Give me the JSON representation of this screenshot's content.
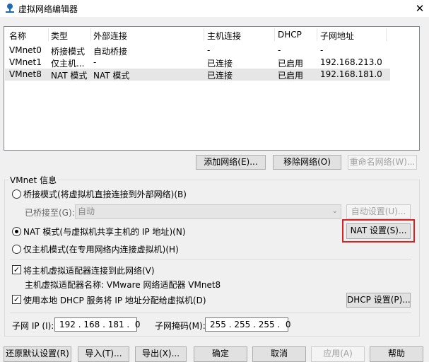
{
  "window": {
    "title": "虚拟网络编辑器",
    "close_glyph": "✕"
  },
  "table": {
    "columns": [
      "名称",
      "类型",
      "外部连接",
      "主机连接",
      "DHCP",
      "子网地址"
    ],
    "rows": [
      {
        "name": "VMnet0",
        "type": "桥接模式",
        "external": "自动桥接",
        "host": "-",
        "dhcp": "-",
        "subnet": "-",
        "selected": false
      },
      {
        "name": "VMnet1",
        "type": "仅主机...",
        "external": "-",
        "host": "已连接",
        "dhcp": "已启用",
        "subnet": "192.168.213.0",
        "selected": false
      },
      {
        "name": "VMnet8",
        "type": "NAT 模式",
        "external": "NAT 模式",
        "host": "已连接",
        "dhcp": "已启用",
        "subnet": "192.168.181.0",
        "selected": true
      }
    ]
  },
  "table_buttons": {
    "add": "添加网络(E)...",
    "remove": "移除网络(O)",
    "rename": "重命名网络(W)..."
  },
  "vmnet_info": {
    "group_title": "VMnet 信息",
    "bridged_label": "桥接模式(将虚拟机直接连接到外部网络)(B)",
    "bridged_to_label": "已桥接至(G):",
    "bridged_to_value": "自动",
    "auto_settings": "自动设置(U)...",
    "nat_label": "NAT 模式(与虚拟机共享主机的 IP 地址)(N)",
    "nat_settings": "NAT 设置(S)...",
    "hostonly_label": "仅主机模式(在专用网络内连接虚拟机)(H)",
    "mode_selected": "nat",
    "connect_adapter_label": "将主机虚拟适配器连接到此网络(V)",
    "connect_adapter_checked": true,
    "adapter_name_label": "主机虚拟适配器名称: VMware 网络适配器 VMnet8",
    "dhcp_label": "使用本地 DHCP 服务将 IP 地址分配给虚拟机(D)",
    "dhcp_checked": true,
    "dhcp_settings": "DHCP 设置(P)...",
    "subnet_ip_label": "子网 IP (I):",
    "subnet_ip_value": "192 . 168 . 181 .  0",
    "subnet_mask_label": "子网掩码(M):",
    "subnet_mask_value": "255 . 255 . 255 .  0"
  },
  "footer": {
    "restore": "还原默认设置(R)",
    "import": "导入(T)...",
    "export": "导出(X)...",
    "ok": "确定",
    "cancel": "取消",
    "apply": "应用(A)",
    "help": "帮助"
  },
  "colors": {
    "highlight": "#e02020",
    "selection": "#e6e6e6",
    "icon": "#1e6ab3"
  },
  "icons": {
    "app": "vmware-network-icon",
    "combo_arrow": "chevron-down-icon"
  }
}
